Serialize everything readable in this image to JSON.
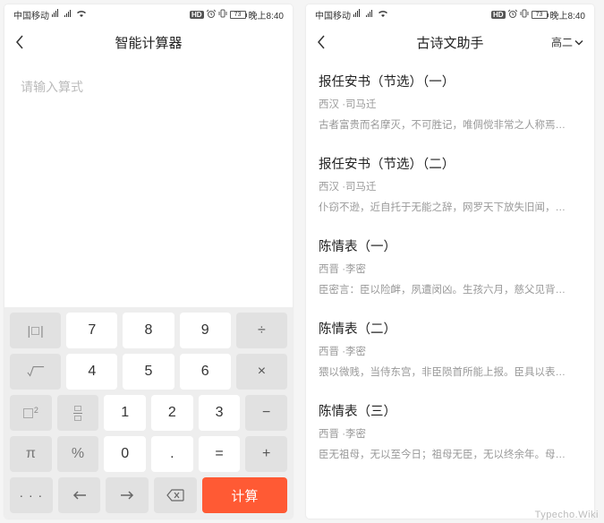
{
  "status": {
    "carrier": "中国移动",
    "hd": "HD",
    "battery": "73",
    "time": "晚上8:40"
  },
  "calculator": {
    "title": "智能计算器",
    "placeholder": "请输入算式",
    "keys": {
      "abs": "|□|",
      "n7": "7",
      "n8": "8",
      "n9": "9",
      "div": "÷",
      "sqrt": "√",
      "n4": "4",
      "n5": "5",
      "n6": "6",
      "mul": "×",
      "sq": "□",
      "sq_sup": "2",
      "n1": "1",
      "n2": "2",
      "n3": "3",
      "sub": "−",
      "pi": "π",
      "pct": "%",
      "n0": "0",
      "dot": ".",
      "eq": "=",
      "add": "+",
      "more": "· · ·",
      "left": "←",
      "right": "→",
      "del": "⌫",
      "calc": "计算"
    }
  },
  "poems": {
    "title": "古诗文助手",
    "grade": "高二",
    "items": [
      {
        "title": "报任安书（节选）（一）",
        "author": "西汉 ·司马迁",
        "excerpt": "古者富贵而名摩灭，不可胜记，唯倜傥非常之人称焉…"
      },
      {
        "title": "报任安书（节选）（二）",
        "author": "西汉 ·司马迁",
        "excerpt": "仆窃不逊，近自托于无能之辞，网罗天下放失旧闻，…"
      },
      {
        "title": "陈情表（一）",
        "author": "西晋 ·李密",
        "excerpt": "臣密言：臣以险衅，夙遭闵凶。生孩六月，慈父见背…"
      },
      {
        "title": "陈情表（二）",
        "author": "西晋 ·李密",
        "excerpt": "猥以微贱，当侍东宫，非臣陨首所能上报。臣具以表…"
      },
      {
        "title": "陈情表（三）",
        "author": "西晋 ·李密",
        "excerpt": "臣无祖母，无以至今日；祖母无臣，无以终余年。母…"
      }
    ]
  },
  "watermark": "Typecho.Wiki"
}
